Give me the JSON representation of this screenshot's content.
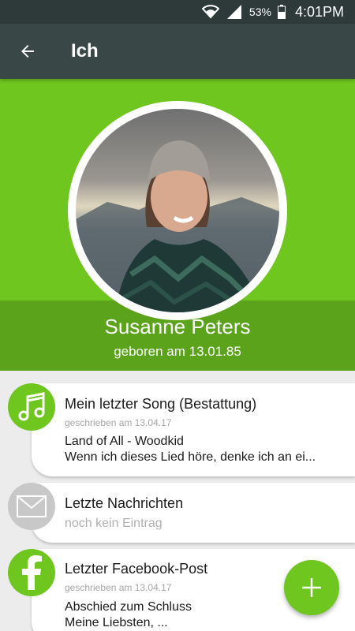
{
  "status_bar": {
    "battery": "53%",
    "time": "4:01PM"
  },
  "app_bar": {
    "title": "Ich"
  },
  "profile": {
    "name": "Susanne Peters",
    "dob": "geboren am 13.01.85"
  },
  "cards": [
    {
      "title": "Mein letzter Song (Bestattung)",
      "date": "geschrieben am 13.04.17",
      "line1": "Land of All - Woodkid",
      "line2": "Wenn ich dieses Lied höre, denke ich an ei..."
    },
    {
      "title": "Letzte Nachrichten",
      "empty": "noch kein Eintrag"
    },
    {
      "title": "Letzter Facebook-Post",
      "date": "geschrieben am 13.04.17",
      "line1": "Abschied zum Schluss",
      "line2": "Meine Liebsten, ..."
    }
  ],
  "colors": {
    "green": "#6ec61e",
    "dark_green": "#5ba31a",
    "app_bar": "#3a4747",
    "gray_icon": "#c8c8c8"
  },
  "icons": [
    "wifi-icon",
    "signal-icon",
    "battery-icon",
    "back-arrow-icon",
    "music-note-icon",
    "envelope-icon",
    "facebook-icon",
    "plus-icon"
  ]
}
